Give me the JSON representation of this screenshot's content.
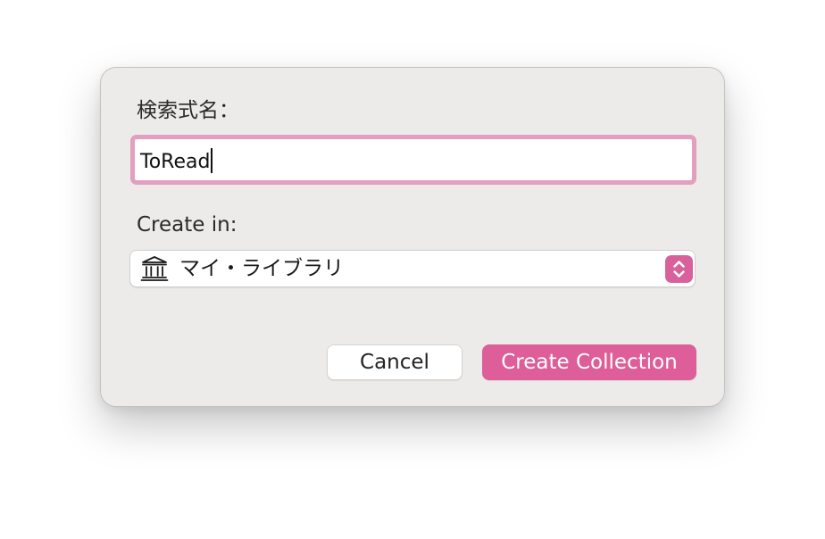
{
  "dialog": {
    "name_label": "検索式名：",
    "name_value": "ToRead",
    "create_in_label": "Create in:",
    "create_in_value": "マイ・ライブラリ",
    "create_in_icon": "library-building-icon",
    "stepper_icon": "up-down-chevrons-icon",
    "cancel_label": "Cancel",
    "create_label": "Create Collection"
  },
  "colors": {
    "accent": "#dd5e98",
    "focus_ring": "#e39ec0",
    "dialog_background": "#ecebea"
  }
}
